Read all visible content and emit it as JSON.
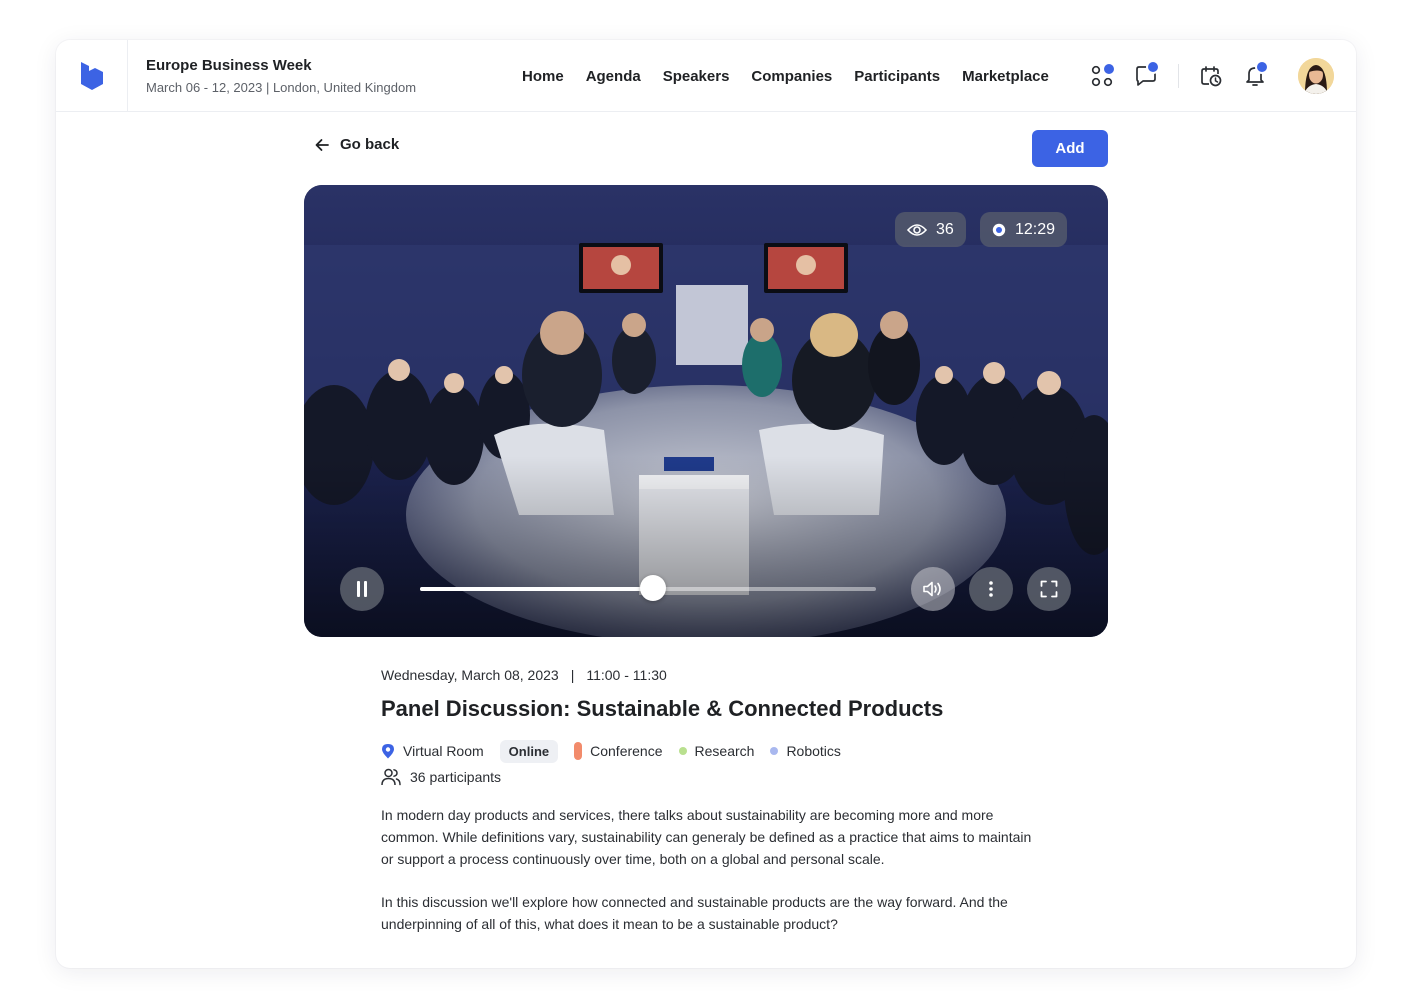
{
  "header": {
    "event_title": "Europe Business Week",
    "event_subtitle": "March 06 - 12, 2023 | London, United Kingdom",
    "nav": [
      "Home",
      "Agenda",
      "Speakers",
      "Companies",
      "Participants",
      "Marketplace"
    ],
    "icons": [
      "apps-icon",
      "chat-icon",
      "calendar-clock-icon",
      "bell-icon"
    ],
    "accent_color": "#3c63e4"
  },
  "actions": {
    "go_back_label": "Go back",
    "add_label": "Add"
  },
  "video": {
    "viewers": "36",
    "elapsed": "12:29",
    "progress": 0.51,
    "state": "playing"
  },
  "session": {
    "date": "Wednesday, March 08, 2023",
    "time": "11:00 - 11:30",
    "title": "Panel Discussion: Sustainable & Connected Products",
    "location": "Virtual Room",
    "mode_tag": "Online",
    "categories": [
      {
        "label": "Conference",
        "color": "#f28b6b"
      },
      {
        "label": "Research",
        "color": "#b9e08f"
      },
      {
        "label": "Robotics",
        "color": "#a9b8ef"
      }
    ],
    "participants": "36 participants",
    "description": [
      "In modern day products and services, there talks about sustainability are becoming more and more common. While definitions vary, sustainability can generaly be defined as a practice that aims to maintain or support a process continuously over time, both on a global and personal scale.",
      "In this discussion we'll explore how connected and sustainable products are the way forward. And the underpinning of all of this, what does it mean to be a sustainable product?"
    ]
  }
}
